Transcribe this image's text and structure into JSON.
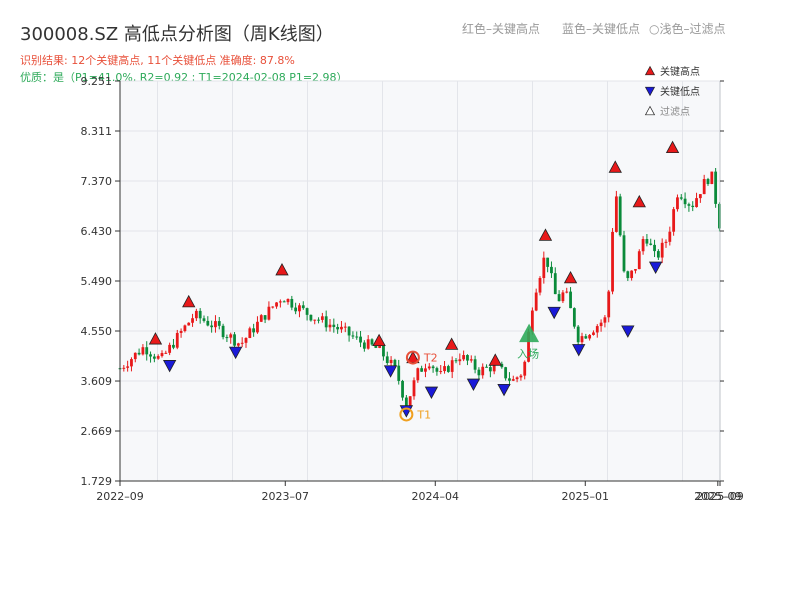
{
  "header": {
    "title": "300008.SZ 高低点分析图（周K线图）",
    "legend_red": "红色–关键高点",
    "legend_blue": "蓝色–关键低点",
    "legend_filtered": "○浅色–过滤点",
    "result_line": "识别结果: 12个关键高点, 11个关键低点  准确度: 87.8%",
    "quality_line": "优质：是（P1=41.0%, R2=0.92 ; T1=2024-02-08 P1=2.98）"
  },
  "colors": {
    "up": "#e8191a",
    "down": "#0a8a3a",
    "high_marker": "#e8191a",
    "low_marker": "#1a1ad8",
    "t1": "#f0a020",
    "t2": "#e8503a",
    "entry": "#2eaa5a",
    "plot_bg": "#f7f8fa"
  },
  "chart_data": {
    "type": "candlestick",
    "frequency": "weekly",
    "ylim": [
      1.729,
      9.251
    ],
    "yticks": [
      "1.729",
      "2.669",
      "3.609",
      "4.550",
      "5.490",
      "6.430",
      "7.370",
      "8.311",
      "9.251"
    ],
    "xlim": [
      "2022-09-01",
      "2025-09-05"
    ],
    "xticks": [
      {
        "date": "2022-09-01",
        "label": "2022–09"
      },
      {
        "date": "2023-07-01",
        "label": "2023–07"
      },
      {
        "date": "2024-04-01",
        "label": "2024–04"
      },
      {
        "date": "2025-01-01",
        "label": "2025–01"
      },
      {
        "date": "2025-09-01",
        "label": "2025–09"
      },
      {
        "date": "2025-09-05",
        "label": "2025–09"
      }
    ],
    "price_path": [
      [
        "2022-09-01",
        3.85
      ],
      [
        "2022-10-15",
        4.25
      ],
      [
        "2022-11-15",
        4.0
      ],
      [
        "2022-12-20",
        4.5
      ],
      [
        "2023-01-15",
        4.85
      ],
      [
        "2023-03-01",
        4.6
      ],
      [
        "2023-04-10",
        4.3
      ],
      [
        "2023-05-20",
        4.8
      ],
      [
        "2023-06-25",
        5.2
      ],
      [
        "2023-08-15",
        4.85
      ],
      [
        "2023-10-15",
        4.55
      ],
      [
        "2023-11-15",
        4.35
      ],
      [
        "2023-12-20",
        4.2
      ],
      [
        "2024-01-20",
        3.8
      ],
      [
        "2024-02-08",
        3.15
      ],
      [
        "2024-02-28",
        3.75
      ],
      [
        "2024-03-20",
        4.0
      ],
      [
        "2024-04-10",
        3.7
      ],
      [
        "2024-05-15",
        4.1
      ],
      [
        "2024-06-20",
        3.8
      ],
      [
        "2024-07-20",
        3.9
      ],
      [
        "2024-08-20",
        3.6
      ],
      [
        "2024-09-10",
        3.8
      ],
      [
        "2024-09-28",
        5.2
      ],
      [
        "2024-10-20",
        6.0
      ],
      [
        "2024-11-10",
        5.1
      ],
      [
        "2024-11-25",
        5.3
      ],
      [
        "2024-12-20",
        4.4
      ],
      [
        "2025-01-15",
        4.6
      ],
      [
        "2025-02-10",
        4.8
      ],
      [
        "2025-02-25",
        7.3
      ],
      [
        "2025-03-15",
        5.4
      ],
      [
        "2025-04-05",
        5.8
      ],
      [
        "2025-04-20",
        6.4
      ],
      [
        "2025-05-10",
        5.9
      ],
      [
        "2025-06-01",
        6.3
      ],
      [
        "2025-06-20",
        7.2
      ],
      [
        "2025-07-15",
        6.9
      ],
      [
        "2025-08-05",
        7.3
      ],
      [
        "2025-08-20",
        7.5
      ],
      [
        "2025-09-05",
        6.5
      ]
    ],
    "key_highs": [
      [
        "2022-11-05",
        4.4
      ],
      [
        "2023-01-05",
        5.1
      ],
      [
        "2023-06-25",
        5.7
      ],
      [
        "2023-12-20",
        4.37
      ],
      [
        "2024-02-20",
        4.05
      ],
      [
        "2024-05-01",
        4.3
      ],
      [
        "2024-07-20",
        4.0
      ],
      [
        "2024-10-20",
        6.35
      ],
      [
        "2024-12-05",
        5.55
      ],
      [
        "2025-02-25",
        7.63
      ],
      [
        "2025-04-10",
        6.98
      ],
      [
        "2025-06-10",
        8.0
      ]
    ],
    "key_lows": [
      [
        "2022-12-01",
        3.9
      ],
      [
        "2023-04-01",
        4.15
      ],
      [
        "2024-01-10",
        3.8
      ],
      [
        "2024-03-25",
        3.4
      ],
      [
        "2024-06-10",
        3.55
      ],
      [
        "2024-08-05",
        3.45
      ],
      [
        "2024-11-05",
        4.9
      ],
      [
        "2024-12-20",
        4.2
      ],
      [
        "2025-03-20",
        4.55
      ],
      [
        "2025-05-10",
        5.75
      ],
      [
        "2024-02-08",
        3.05
      ]
    ],
    "annotations": [
      {
        "label": "T1",
        "date": "2024-02-08",
        "value": 2.98
      },
      {
        "label": "T2",
        "date": "2024-02-20",
        "value": 4.05
      },
      {
        "label": "入场",
        "date": "2024-09-20",
        "value": 4.5
      }
    ],
    "legend": [
      {
        "label": "关键高点",
        "symbol": "triangle-up"
      },
      {
        "label": "关键低点",
        "symbol": "triangle-down"
      },
      {
        "label": "过滤点",
        "symbol": "triangle-up-hollow"
      }
    ],
    "grid": true,
    "legend_position": "top-right"
  }
}
